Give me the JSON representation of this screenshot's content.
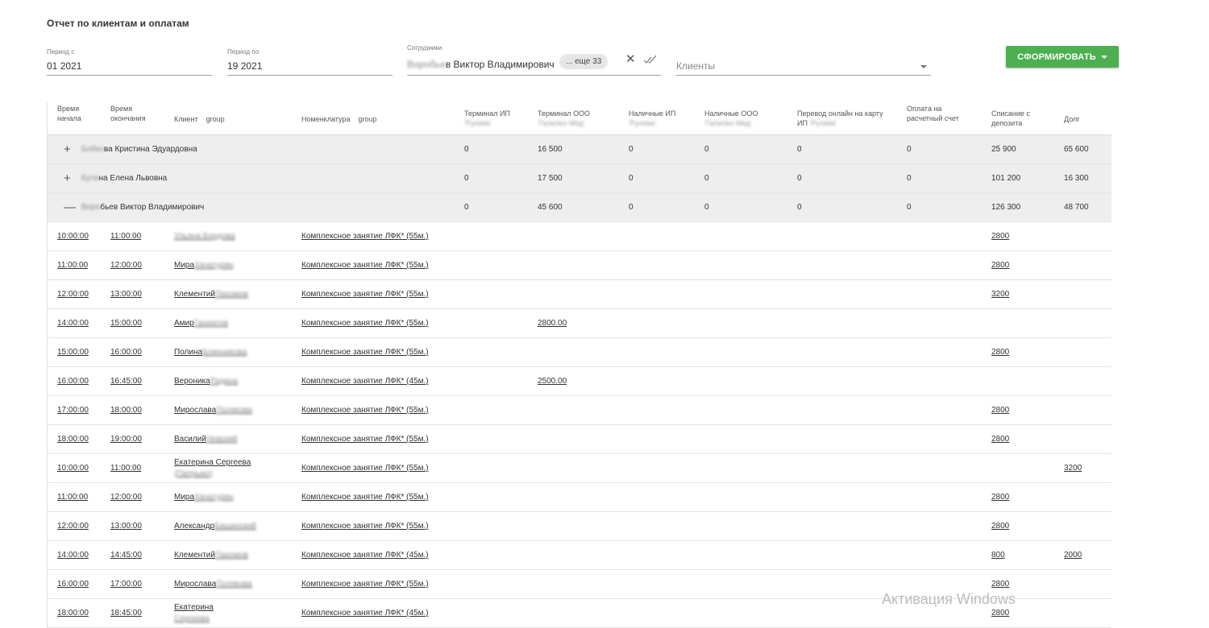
{
  "page": {
    "title": "Отчет по клиентам и оплатам"
  },
  "filters": {
    "period_from": {
      "label": "Период с",
      "day": "01",
      "month": "  ",
      "year": "2021"
    },
    "period_to": {
      "label": "Период по",
      "day": "19",
      "month": "  ",
      "year": "2021"
    },
    "employees": {
      "label": "Сотрудники",
      "name_blur": "Воробье",
      "name_rest": "в Виктор Владимирович",
      "chip": "... еще 33"
    },
    "clients": {
      "placeholder": "Клиенты"
    },
    "generate_button": "СФОРМИРОВАТЬ",
    "accent_color": "#4caf50"
  },
  "table": {
    "columns": {
      "start": [
        "Время",
        "начала"
      ],
      "end": [
        "Время",
        "окончания"
      ],
      "client": "Клиент",
      "client_group": "group",
      "nomenclature": "Номенклатура",
      "nomenclature_group": "group",
      "terminal_ip": "Терминал ИП",
      "terminal_ip_sub": "'Рулева'",
      "terminal_ooo": "Терминал ООО",
      "terminal_ooo_sub": "'Галилео Мед'",
      "cash_ip": "Наличные ИП",
      "cash_ip_sub": "'Рулева'",
      "cash_ooo": "Наличные ООО",
      "cash_ooo_sub": "'Галилео Мед'",
      "transfer": [
        "Перевод онлайн на карту",
        "ИП "
      ],
      "transfer_sub": "'Рулева'",
      "account": [
        "Оплата на",
        "расчетный счет"
      ],
      "deposit": [
        "Списание с",
        "депозита"
      ],
      "debt": "Долг"
    },
    "groups": [
      {
        "icon": "+",
        "name_blur": "Бобко",
        "name_rest": "ва Кристина Эдуардовна",
        "terminal_ip": "0",
        "terminal_ooo": "16 500",
        "cash_ip": "0",
        "cash_ooo": "0",
        "transfer": "0",
        "account": "0",
        "deposit": "25 900",
        "debt": "65 600"
      },
      {
        "icon": "+",
        "name_blur": "Бути",
        "name_rest": "на Елена Львовна",
        "terminal_ip": "0",
        "terminal_ooo": "17 500",
        "cash_ip": "0",
        "cash_ooo": "0",
        "transfer": "0",
        "account": "0",
        "deposit": "101 200",
        "debt": "16 300"
      },
      {
        "icon": "—",
        "name_blur": "Воро",
        "name_rest": "бьев Виктор Владимирович",
        "terminal_ip": "0",
        "terminal_ooo": "45 600",
        "cash_ip": "0",
        "cash_ooo": "0",
        "transfer": "0",
        "account": "0",
        "deposit": "126 300",
        "debt": "48 700"
      }
    ],
    "rows": [
      {
        "start": "10:00:00",
        "end": "11:00:00",
        "client": "",
        "client_blur": "Ульяна Бордова",
        "service": "Комплексное занятие ЛФК* (55м.)",
        "terminal_ooo": "",
        "deposit": "2800",
        "debt": ""
      },
      {
        "start": "11:00:00",
        "end": "12:00:00",
        "client": "Мира",
        "client_blur": " Хачатурян",
        "service": "Комплексное занятие ЛФК* (55м.)",
        "terminal_ooo": "",
        "deposit": "2800",
        "debt": ""
      },
      {
        "start": "12:00:00",
        "end": "13:00:00",
        "client": "Клементий",
        "client_blur": " Пахомов",
        "service": "Комплексное занятие ЛФК* (55м.)",
        "terminal_ooo": "",
        "deposit": "3200",
        "debt": ""
      },
      {
        "start": "14:00:00",
        "end": "15:00:00",
        "client": "Амир",
        "client_blur": " Ганиатов",
        "service": "Комплексное занятие ЛФК* (55м.)",
        "terminal_ooo": "2800.00",
        "deposit": "",
        "debt": ""
      },
      {
        "start": "15:00:00",
        "end": "16:00:00",
        "client": "Полина",
        "client_blur": " Блинникова",
        "service": "Комплексное занятие ЛФК* (55м.)",
        "terminal_ooo": "",
        "deposit": "2800",
        "debt": ""
      },
      {
        "start": "16:00:00",
        "end": "16:45:00",
        "client": "Вероника",
        "client_blur": " Радина",
        "service": "Комплексное занятие ЛФК* (45м.)",
        "terminal_ooo": "2500.00",
        "deposit": "",
        "debt": ""
      },
      {
        "start": "17:00:00",
        "end": "18:00:00",
        "client": "Мирослава",
        "client_blur": " Полякова",
        "service": "Комплексное занятие ЛФК* (55м.)",
        "terminal_ooo": "",
        "deposit": "2800",
        "debt": ""
      },
      {
        "start": "18:00:00",
        "end": "19:00:00",
        "client": "Василий",
        "client_blur": " Невский",
        "service": "Комплексное занятие ЛФК* (55м.)",
        "terminal_ooo": "",
        "deposit": "2800",
        "debt": ""
      },
      {
        "start": "10:00:00",
        "end": "11:00:00",
        "client": "Екатерина Сергеева",
        "client_blur": "(Папрыко)",
        "service": "Комплексное занятие ЛФК* (55м.)",
        "terminal_ooo": "",
        "deposit": "",
        "debt": "3200",
        "two_line": true
      },
      {
        "start": "11:00:00",
        "end": "12:00:00",
        "client": "Мира",
        "client_blur": " Хачатурян",
        "service": "Комплексное занятие ЛФК* (55м.)",
        "terminal_ooo": "",
        "deposit": "2800",
        "debt": ""
      },
      {
        "start": "12:00:00",
        "end": "13:00:00",
        "client": "Александр",
        "client_blur": " Башинский",
        "service": "Комплексное занятие ЛФК* (55м.)",
        "terminal_ooo": "",
        "deposit": "2800",
        "debt": ""
      },
      {
        "start": "14:00:00",
        "end": "14:45:00",
        "client": "Клементий",
        "client_blur": " Пахомов",
        "service": "Комплексное занятие ЛФК* (45м.)",
        "terminal_ooo": "",
        "deposit": "800",
        "debt": "2000"
      },
      {
        "start": "16:00:00",
        "end": "17:00:00",
        "client": "Мирослава",
        "client_blur": " Полякова",
        "service": "Комплексное занятие ЛФК* (55м.)",
        "terminal_ooo": "",
        "deposit": "2800",
        "debt": ""
      },
      {
        "start": "18:00:00",
        "end": "18:45:00",
        "client": "Екатерина",
        "client_blur": " Сергеева",
        "service": "Комплексное занятие ЛФК* (45м.)",
        "terminal_ooo": "",
        "deposit": "2800",
        "debt": "",
        "two_line": true
      }
    ]
  },
  "watermark": "Активация Windows"
}
